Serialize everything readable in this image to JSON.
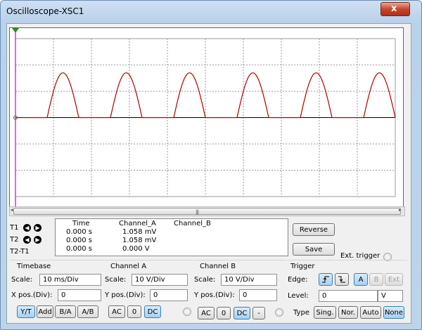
{
  "window": {
    "title": "Oscilloscope-XSC1",
    "close_label": "x"
  },
  "screen": {
    "background": "#ffffff",
    "grid_color": "#9a9a9a",
    "trace_color": "#b00000",
    "cursor_color": "#cc00cc",
    "channel_a": {
      "waveform": "half-wave rectified sine",
      "peak_mV": 1.058,
      "volts_per_div_mV": 10,
      "time_per_div_ms": 10,
      "cycles_shown": 6
    }
  },
  "measurements": {
    "rows": [
      "T1",
      "T2",
      "T2-T1"
    ],
    "columns": [
      "Time",
      "Channel_A",
      "Channel_B"
    ],
    "time": [
      "0.000 s",
      "0.000 s",
      "0.000 s"
    ],
    "channel_a": [
      "1.058 mV",
      "1.058 mV",
      "0.000 V"
    ],
    "channel_b": [
      "",
      "",
      ""
    ]
  },
  "buttons": {
    "reverse": "Reverse",
    "save": "Save",
    "ext_trigger": "Ext. trigger"
  },
  "timebase": {
    "title": "Timebase",
    "scale_label": "Scale:",
    "scale_value": "10 ms/Div",
    "xpos_label": "X pos.(Div):",
    "xpos_value": "0",
    "modes": [
      "Y/T",
      "Add",
      "B/A",
      "A/B"
    ]
  },
  "channel_a": {
    "title": "Channel A",
    "scale_label": "Scale:",
    "scale_value": "10  V/Div",
    "ypos_label": "Y pos.(Div):",
    "ypos_value": "0",
    "coupling": [
      "AC",
      "0",
      "DC"
    ]
  },
  "channel_b": {
    "title": "Channel B",
    "scale_label": "Scale:",
    "scale_value": "10  V/Div",
    "ypos_label": "Y pos.(Div):",
    "ypos_value": "0",
    "coupling": [
      "AC",
      "0",
      "DC",
      "-"
    ]
  },
  "trigger": {
    "title": "Trigger",
    "edge_label": "Edge:",
    "sources": [
      "A",
      "B",
      "Ext"
    ],
    "level_label": "Level:",
    "level_value": "0",
    "level_unit": "V",
    "type_label": "Type",
    "types": [
      "Sing.",
      "Nor.",
      "Auto",
      "None"
    ]
  },
  "colors": {
    "accent": "#a6d0f2",
    "trace": "#b00000"
  }
}
